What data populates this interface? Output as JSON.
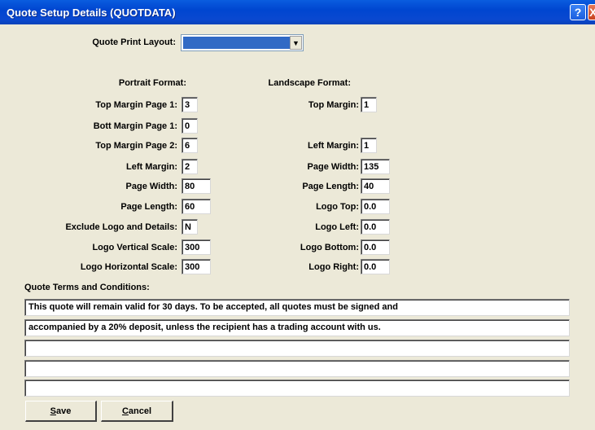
{
  "window": {
    "title": "Quote Setup Details (QUOTDATA)",
    "help_glyph": "?",
    "close_glyph": "X"
  },
  "print_layout": {
    "label": "Quote Print Layout:",
    "value": ""
  },
  "portrait": {
    "heading": "Portrait Format:",
    "top_margin_p1": {
      "label": "Top Margin Page 1:",
      "value": "3"
    },
    "bott_margin_p1": {
      "label": "Bott Margin Page 1:",
      "value": "0"
    },
    "top_margin_p2": {
      "label": "Top Margin Page 2:",
      "value": "6"
    },
    "left_margin": {
      "label": "Left Margin:",
      "value": "2"
    },
    "page_width": {
      "label": "Page Width:",
      "value": "80"
    },
    "page_length": {
      "label": "Page Length:",
      "value": "60"
    },
    "exclude_logo": {
      "label": "Exclude Logo and Details:",
      "value": "N"
    },
    "logo_vscale": {
      "label": "Logo Vertical Scale:",
      "value": "300"
    },
    "logo_hscale": {
      "label": "Logo Horizontal Scale:",
      "value": "300"
    }
  },
  "landscape": {
    "heading": "Landscape Format:",
    "top_margin": {
      "label": "Top Margin:",
      "value": "1"
    },
    "left_margin": {
      "label": "Left Margin:",
      "value": "1"
    },
    "page_width": {
      "label": "Page Width:",
      "value": "135"
    },
    "page_length": {
      "label": "Page Length:",
      "value": "40"
    },
    "logo_top": {
      "label": "Logo Top:",
      "value": "0.0"
    },
    "logo_left": {
      "label": "Logo Left:",
      "value": "0.0"
    },
    "logo_bottom": {
      "label": "Logo Bottom:",
      "value": "0.0"
    },
    "logo_right": {
      "label": "Logo Right:",
      "value": "0.0"
    }
  },
  "terms": {
    "heading": "Quote Terms and Conditions:",
    "lines": [
      "This quote will remain valid for 30 days.   To be accepted, all quotes must be signed and",
      "accompanied by a 20% deposit, unless the recipient has a trading account with us.",
      "",
      "",
      ""
    ]
  },
  "buttons": {
    "save_mnemonic": "S",
    "save_rest": "ave",
    "cancel_mnemonic": "C",
    "cancel_rest": "ancel"
  },
  "colors": {
    "titlebar": "#0a48d0",
    "dialog_bg": "#ece9d8",
    "selection": "#316ac5"
  }
}
